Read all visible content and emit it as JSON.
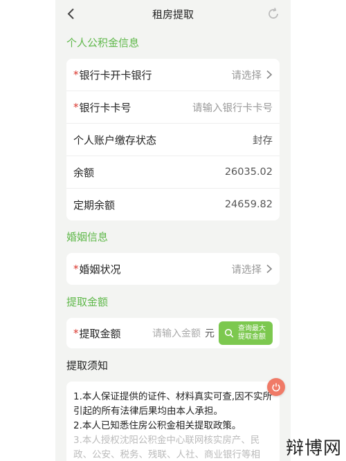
{
  "header": {
    "title": "租房提取"
  },
  "personal": {
    "section_title": "个人公积金信息",
    "bank": {
      "required": "*",
      "label": "银行卡开卡银行",
      "placeholder": "请选择"
    },
    "card_no": {
      "required": "*",
      "label": "银行卡卡号",
      "placeholder": "请输入银行卡卡号"
    },
    "status": {
      "label": "个人账户缴存状态",
      "value": "封存"
    },
    "balance": {
      "label": "余额",
      "value": "26035.02"
    },
    "fixed_balance": {
      "label": "定期余额",
      "value": "24659.82"
    }
  },
  "marriage": {
    "section_title": "婚姻信息",
    "status": {
      "required": "*",
      "label": "婚姻状况",
      "placeholder": "请选择"
    }
  },
  "amount": {
    "section_title": "提取金额",
    "field": {
      "required": "*",
      "label": "提取金额",
      "placeholder": "请输入金额",
      "unit": "元"
    },
    "query_button": {
      "line1": "查询最大",
      "line2": "提取金额"
    }
  },
  "notice": {
    "section_title": "提取须知",
    "items": [
      "1.本人保证提供的证件、材料真实可查,因不实所引起的所有法律后果均由本人承担。",
      "2.本人已知悉住房公积金相关提取政策。",
      "3.本人授权沈阳公积金中心联网核实房产、民政、公安、税务、残联、人社、商业银行等相"
    ]
  },
  "watermark": "辩博网",
  "colors": {
    "accent": "#5fb84a",
    "button": "#7cc84f",
    "required": "#d9342b",
    "float": "#f07a67"
  }
}
